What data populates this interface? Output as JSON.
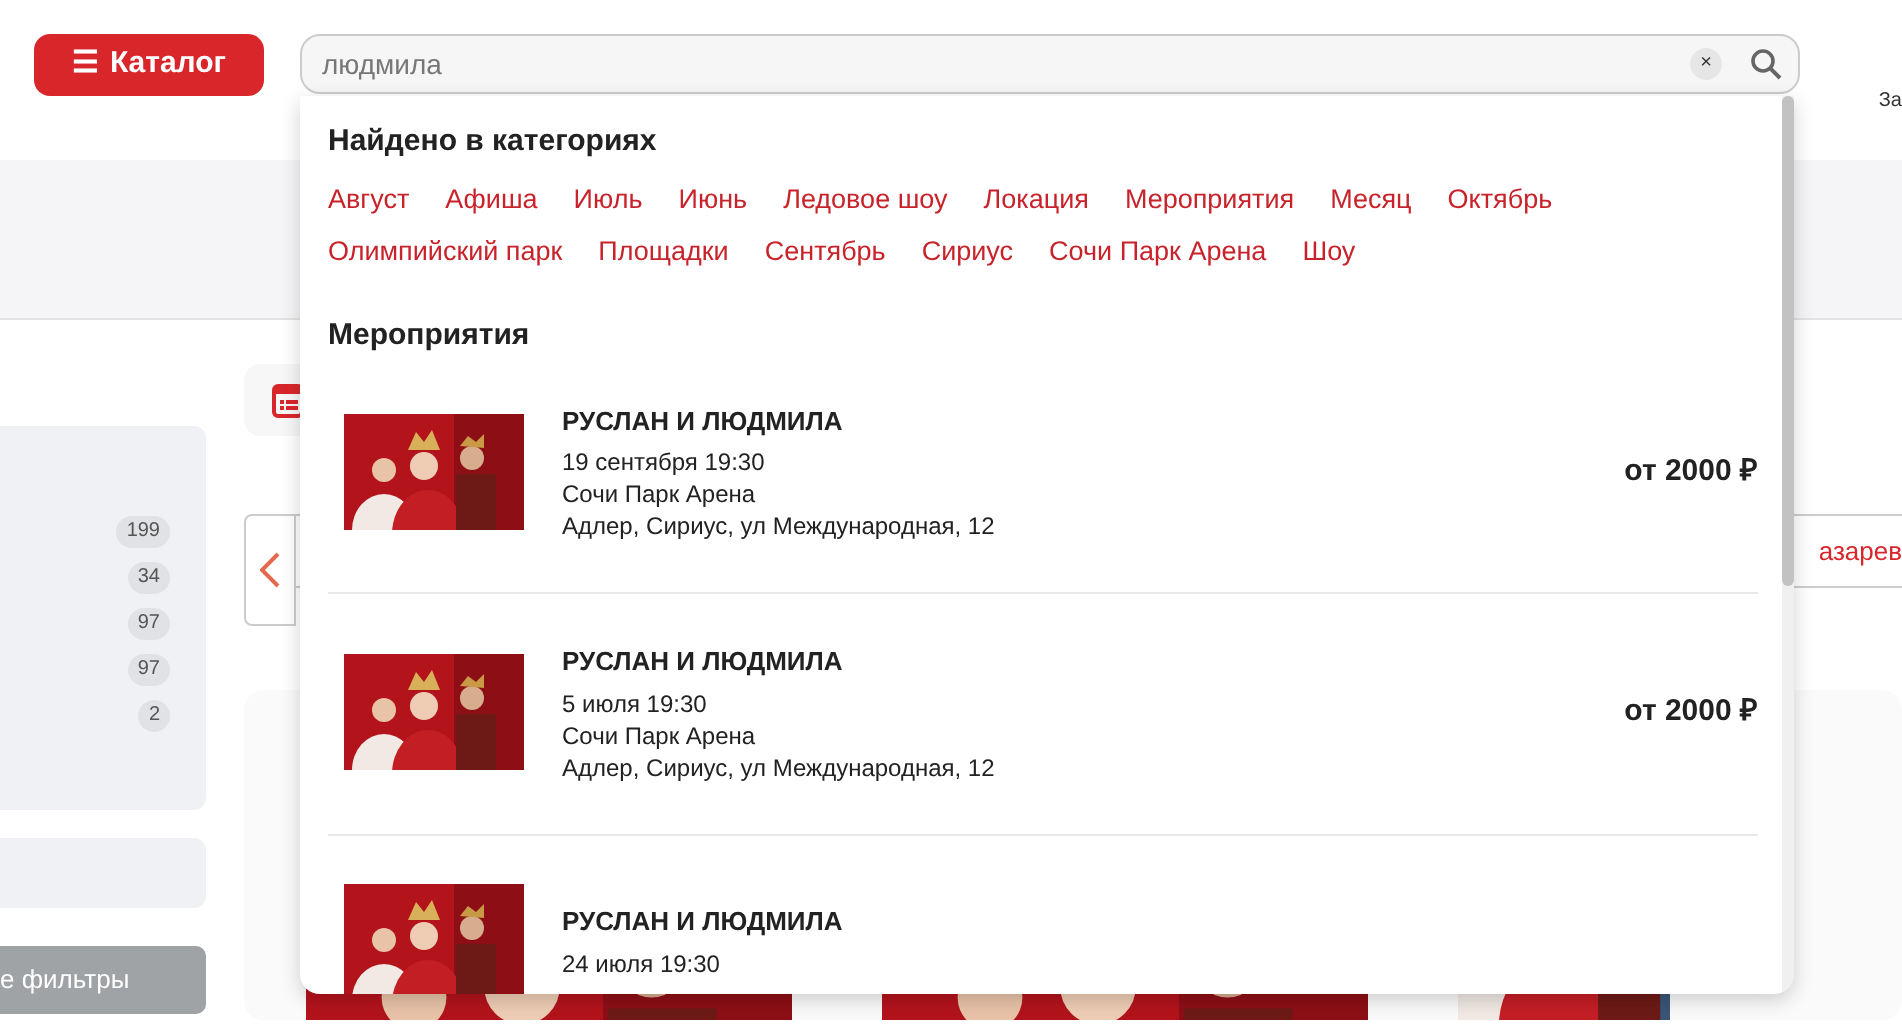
{
  "header": {
    "catalog_button": {
      "icon": "☰",
      "label": "Каталог"
    },
    "search": {
      "value": "людмила",
      "clear": "×"
    },
    "corner_text": "За"
  },
  "sidebar": {
    "counts": [
      "199",
      "34",
      "97",
      "97",
      "2"
    ],
    "reset_button": "е фильтры"
  },
  "content": {
    "carousel_text": "азарев"
  },
  "dropdown": {
    "categories_title": "Найдено в категориях",
    "categories": [
      "Август",
      "Афиша",
      "Июль",
      "Июнь",
      "Ледовое шоу",
      "Локация",
      "Мероприятия",
      "Месяц",
      "Октябрь",
      "Олимпийский парк",
      "Площадки",
      "Сентябрь",
      "Сириус",
      "Сочи Парк Арена",
      "Шоу"
    ],
    "events_title": "Мероприятия",
    "events": [
      {
        "title": "РУСЛАН И ЛЮДМИЛА",
        "date": "19 сентября 19:30",
        "venue": "Сочи Парк Арена",
        "address": "Адлер, Сириус, ул Международная, 12",
        "price": "от 2000 ₽"
      },
      {
        "title": "РУСЛАН И ЛЮДМИЛА",
        "date": "5 июля 19:30",
        "venue": "Сочи Парк Арена",
        "address": "Адлер, Сириус, ул Международная, 12",
        "price": "от 2000 ₽"
      },
      {
        "title": "РУСЛАН И ЛЮДМИЛА",
        "date": "24 июля 19:30"
      }
    ]
  }
}
